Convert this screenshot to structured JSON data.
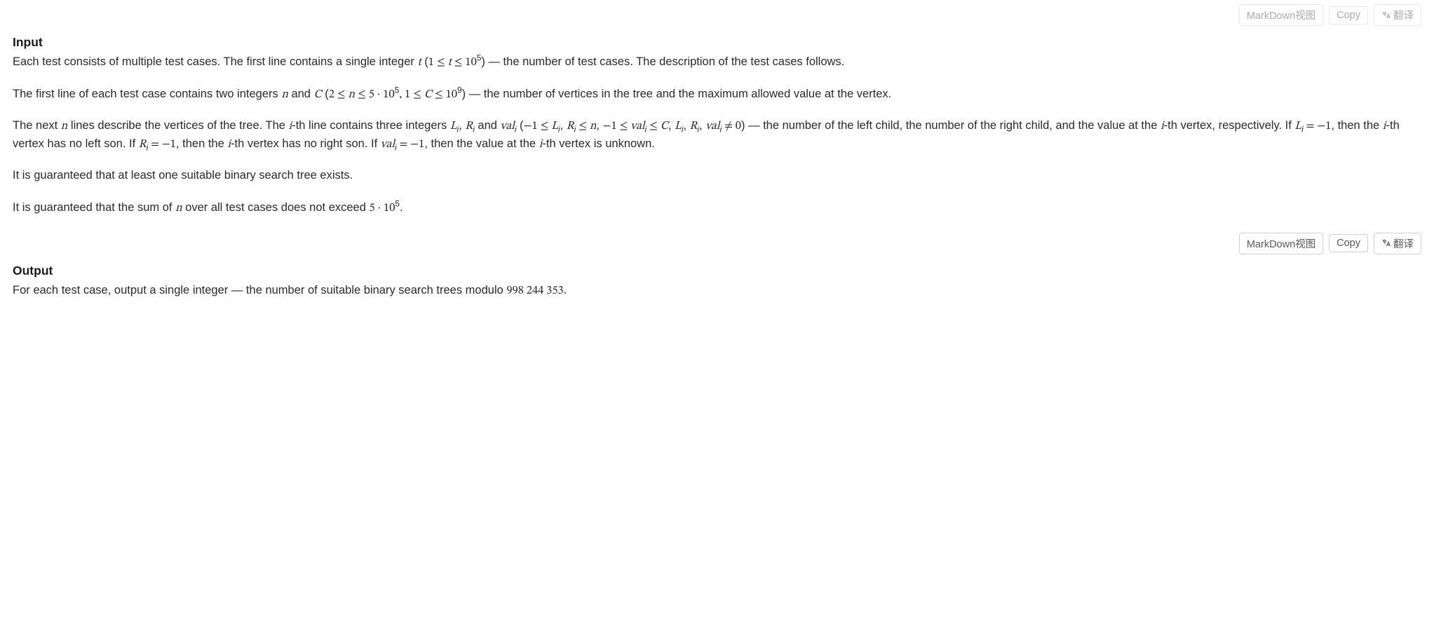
{
  "toolbar": {
    "markdown_label": "MarkDown视图",
    "copy_label": "Copy",
    "translate_label": "翻译"
  },
  "input": {
    "heading": "Input",
    "p1_a": "Each test consists of multiple test cases. The first line contains a single integer ",
    "p1_var_t": "t",
    "p1_b": " (",
    "p1_rel1": "1 ≤ ",
    "p1_var_t2": "t",
    "p1_rel2": " ≤ 10",
    "p1_sup5": "5",
    "p1_c": ") — the number of test cases. The description of the test cases follows.",
    "p2_a": "The first line of each test case contains two integers ",
    "p2_var_n": "n",
    "p2_b": " and ",
    "p2_var_C": "C",
    "p2_c": " (",
    "p2_rel1": "2 ≤ ",
    "p2_var_n2": "n",
    "p2_rel2": " ≤ 5 · 10",
    "p2_sup5": "5",
    "p2_comma": ", ",
    "p2_rel3": "1 ≤ ",
    "p2_var_C2": "C",
    "p2_rel4": " ≤ 10",
    "p2_sup9": "9",
    "p2_d": ") — the number of vertices in the tree and the maximum allowed value at the vertex.",
    "p3_a": "The next ",
    "p3_var_n": "n",
    "p3_b": " lines describe the vertices of the tree. The ",
    "p3_var_i": "i",
    "p3_c": "-th line contains three integers ",
    "p3_L": "L",
    "p3_sub_i1": "i",
    "p3_comma1": ", ",
    "p3_R": "R",
    "p3_sub_i2": "i",
    "p3_and": " and ",
    "p3_val": "val",
    "p3_sub_i3": "i",
    "p3_d": " (",
    "p3_rel1": "−1 ≤ ",
    "p3_L2": "L",
    "p3_sub_i4": "i",
    "p3_comma2": ", ",
    "p3_R2": "R",
    "p3_sub_i5": "i",
    "p3_rel2": " ≤ ",
    "p3_var_n2": "n",
    "p3_comma3": ", ",
    "p3_rel3": "−1 ≤ ",
    "p3_val2": "val",
    "p3_sub_i6": "i",
    "p3_rel4": " ≤ ",
    "p3_var_C": "C",
    "p3_comma4": ", ",
    "p3_L3": "L",
    "p3_sub_i7": "i",
    "p3_comma5": ", ",
    "p3_R3": "R",
    "p3_sub_i8": "i",
    "p3_comma6": ", ",
    "p3_val3": "val",
    "p3_sub_i9": "i",
    "p3_neq": " ≠ 0",
    "p3_e": ") — the number of the left child, the number of the right child, and the value at the ",
    "p3_var_i2": "i",
    "p3_f": "-th vertex, respectively. If ",
    "p3_L4": "L",
    "p3_sub_i10": "i",
    "p3_eq1": " = −1",
    "p3_g": ", then the ",
    "p3_var_i3": "i",
    "p3_h": "-th vertex has no left son. If ",
    "p3_R4": "R",
    "p3_sub_i11": "i",
    "p3_eq2": " = −1",
    "p3_i": ", then the ",
    "p3_var_i4": "i",
    "p3_j": "-th vertex has no right son. If ",
    "p3_val4": "val",
    "p3_sub_i12": "i",
    "p3_eq3": " = −1",
    "p3_k": ", then the value at the ",
    "p3_var_i5": "i",
    "p3_l": "-th vertex is unknown.",
    "p4": "It is guaranteed that at least one suitable binary search tree exists.",
    "p5_a": "It is guaranteed that the sum of ",
    "p5_var_n": "n",
    "p5_b": " over all test cases does not exceed ",
    "p5_lim": "5 · 10",
    "p5_sup5": "5",
    "p5_c": "."
  },
  "output": {
    "heading": "Output",
    "p1_a": "For each test case, output a single integer — the number of suitable binary search trees modulo ",
    "p1_mod": "998 244 353",
    "p1_b": "."
  }
}
